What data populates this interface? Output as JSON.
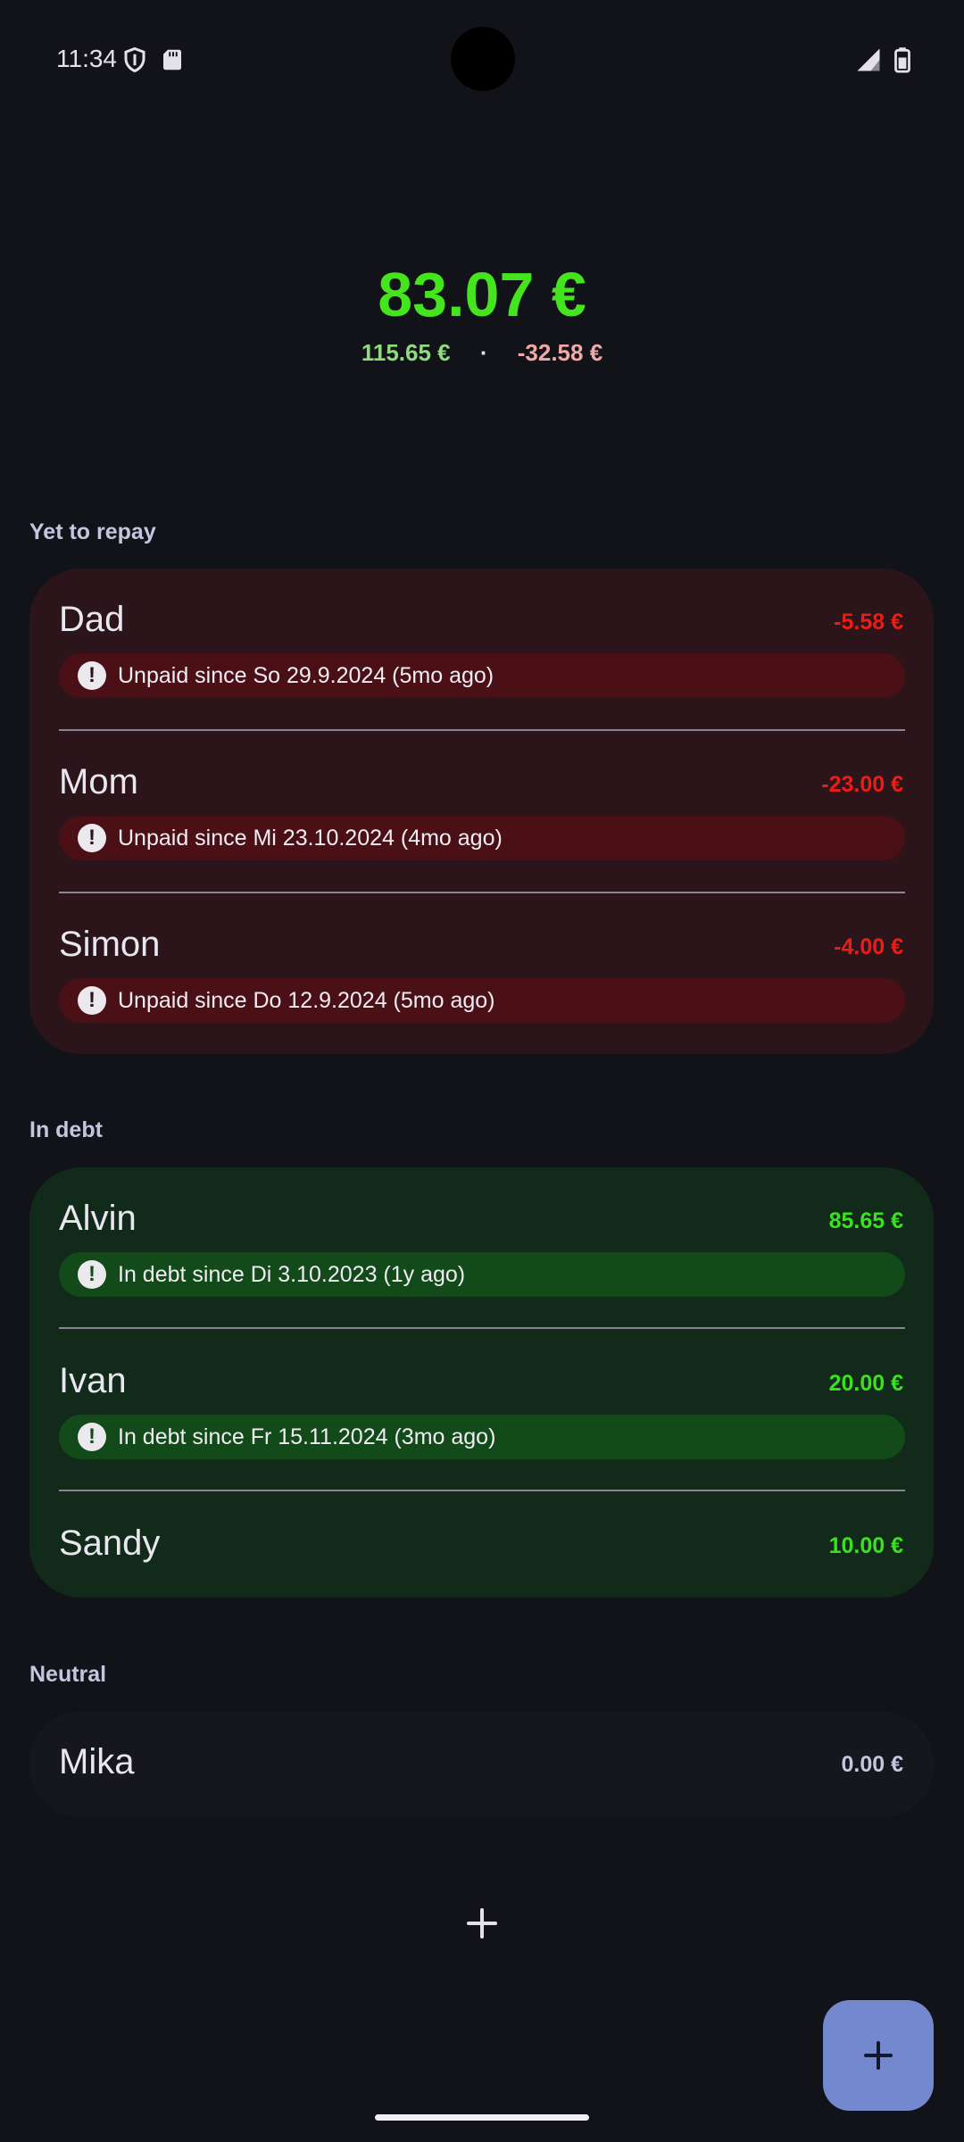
{
  "status_bar": {
    "time": "11:34",
    "icons": [
      "shield-icon",
      "sd-card-icon",
      "signal-icon",
      "battery-icon"
    ]
  },
  "summary": {
    "total": "83.07 €",
    "owed_to_you": "115.65 €",
    "separator": "·",
    "you_owe": "-32.58 €"
  },
  "sections": {
    "repay": {
      "label": "Yet to repay",
      "people": [
        {
          "name": "Dad",
          "amount": "-5.58 €",
          "status": "Unpaid since So 29.9.2024 (5mo ago)"
        },
        {
          "name": "Mom",
          "amount": "-23.00 €",
          "status": "Unpaid since Mi 23.10.2024 (4mo ago)"
        },
        {
          "name": "Simon",
          "amount": "-4.00 €",
          "status": "Unpaid since Do 12.9.2024 (5mo ago)"
        }
      ]
    },
    "debt": {
      "label": "In debt",
      "people": [
        {
          "name": "Alvin",
          "amount": "85.65 €",
          "status": "In debt since Di 3.10.2023 (1y ago)"
        },
        {
          "name": "Ivan",
          "amount": "20.00 €",
          "status": "In debt since Fr 15.11.2024 (3mo ago)"
        },
        {
          "name": "Sandy",
          "amount": "10.00 €"
        }
      ]
    },
    "neutral": {
      "label": "Neutral",
      "people": [
        {
          "name": "Mika",
          "amount": "0.00 €"
        }
      ]
    }
  },
  "colors": {
    "background": "#121318",
    "positive": "#39e21d",
    "negative": "#ec1c17",
    "fab": "#7488d0"
  },
  "alert_glyph": "!"
}
